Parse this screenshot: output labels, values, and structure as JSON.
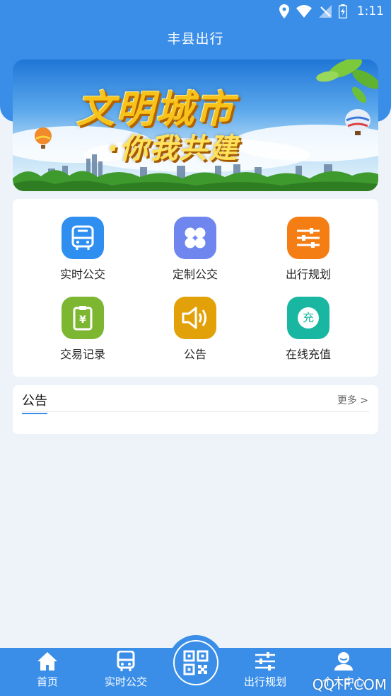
{
  "status_bar": {
    "time": "1:11",
    "icons": [
      "location-icon",
      "wifi-icon",
      "no-sim-icon",
      "battery-icon"
    ]
  },
  "header": {
    "title": "丰县出行"
  },
  "banner": {
    "line1": "文明城市",
    "line2": "·你我共建"
  },
  "grid": {
    "items": [
      {
        "label": "实时公交",
        "icon": "bus-icon",
        "color": "#2f8ff0"
      },
      {
        "label": "定制公交",
        "icon": "clover-icon",
        "color": "#6f86ee"
      },
      {
        "label": "出行规划",
        "icon": "sliders-icon",
        "color": "#f57e14"
      },
      {
        "label": "交易记录",
        "icon": "receipt-icon",
        "color": "#7db631"
      },
      {
        "label": "公告",
        "icon": "speaker-icon",
        "color": "#e2a109"
      },
      {
        "label": "在线充值",
        "icon": "recharge-icon",
        "color": "#19b6a1",
        "badge": "充"
      }
    ]
  },
  "notice": {
    "title": "公告",
    "more": "更多 >"
  },
  "bottom_nav": {
    "items": [
      {
        "label": "首页",
        "icon": "home-icon"
      },
      {
        "label": "实时公交",
        "icon": "bus-icon"
      },
      {
        "label": "出行规划",
        "icon": "sliders-icon"
      },
      {
        "label": "个人中心",
        "icon": "person-icon"
      }
    ],
    "center": {
      "icon": "qr-code-icon"
    }
  },
  "watermark": "QQTF.COM",
  "colors": {
    "primary": "#3a8ee8",
    "page_bg": "#eef3fa"
  }
}
